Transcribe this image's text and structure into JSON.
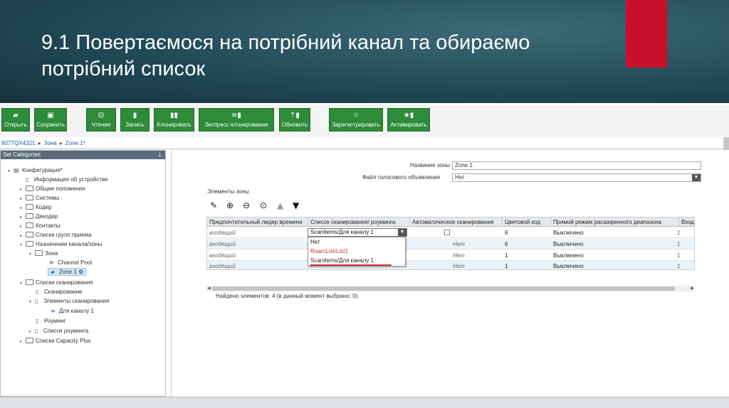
{
  "slide": {
    "title": "9.1 Повертаємося на потрібний канал та обираємо потрібний список",
    "accent_color": "#c8102e"
  },
  "toolbar": {
    "buttons": [
      {
        "label": "Открыть",
        "icon": "folder-icon"
      },
      {
        "label": "Сохранить",
        "icon": "save-icon"
      },
      {
        "label": "Чтение",
        "icon": "read-icon"
      },
      {
        "label": "Запись",
        "icon": "write-icon"
      },
      {
        "label": "Клонировать",
        "icon": "clone-icon"
      },
      {
        "label": "Экспресс-клонирование",
        "icon": "express-clone-icon"
      },
      {
        "label": "Обновить",
        "icon": "update-icon"
      },
      {
        "label": "Зарегистрировать",
        "icon": "register-icon"
      },
      {
        "label": "Активировать",
        "icon": "activate-icon"
      }
    ],
    "color": "#2e8b3a"
  },
  "breadcrumb": [
    "807TQX4321",
    "Зона",
    "Zone 1*"
  ],
  "left_panel": {
    "title": "Set Categories",
    "tree": [
      {
        "label": "Конфигурация*",
        "level": 0,
        "expanded": true
      },
      {
        "label": "Информация об устройстве",
        "level": 1
      },
      {
        "label": "Общие положения",
        "level": 1
      },
      {
        "label": "Системы",
        "level": 1
      },
      {
        "label": "Кодер",
        "level": 1
      },
      {
        "label": "Декодер",
        "level": 1
      },
      {
        "label": "Контакты",
        "level": 1
      },
      {
        "label": "Списки групп приема",
        "level": 1
      },
      {
        "label": "Назначение канала/зоны",
        "level": 1,
        "expanded": true
      },
      {
        "label": "Зона",
        "level": 2,
        "expanded": true
      },
      {
        "label": "Channel Pool",
        "level": 3
      },
      {
        "label": "Zone 1",
        "level": 3,
        "selected": true
      },
      {
        "label": "Списки сканирования",
        "level": 1,
        "expanded": true
      },
      {
        "label": "Сканирование",
        "level": 2
      },
      {
        "label": "Элементы сканирования",
        "level": 2,
        "expanded": true
      },
      {
        "label": "Для каналу 1",
        "level": 3
      },
      {
        "label": "Роуминг",
        "level": 2
      },
      {
        "label": "Список роуминга",
        "level": 2
      },
      {
        "label": "Списки Capacity Plus",
        "level": 1
      }
    ]
  },
  "form": {
    "zone_name_label": "Название зоны",
    "zone_name_value": "Zone 1",
    "voice_file_label": "Файл голосового объявления",
    "voice_file_value": "Нет",
    "elements_label": "Элементы зоны"
  },
  "grid": {
    "columns": [
      "Предпочтительный лидер времени",
      "Список сканирования/ роуминга",
      "Автоматическое сканирование",
      "Цветовой код",
      "Прямой режим расширенного диапазона",
      "Входя"
    ],
    "rows": [
      {
        "leader": "входящий",
        "scan": "ScanItems/Для каналу 1",
        "auto": "",
        "color": "6",
        "direct": "Выключено",
        "in": "1"
      },
      {
        "leader": "входящий",
        "scan": "",
        "auto": "Нет",
        "color": "6",
        "direct": "Выключено",
        "in": "1"
      },
      {
        "leader": "входящий",
        "scan": "",
        "auto": "Нет",
        "color": "1",
        "direct": "Выключено",
        "in": "1"
      },
      {
        "leader": "входящий",
        "scan": "",
        "auto": "Нет",
        "color": "1",
        "direct": "Выключено",
        "in": "1"
      }
    ],
    "dropdown": {
      "selected": "ScanItems/Для каналу 1",
      "options": [
        "Нет",
        "RoamList/List1",
        "ScanItems/Для каналу 1"
      ]
    }
  },
  "status": {
    "found": "Найдено элементов: 4 (в данный момент выбрано: 0)."
  }
}
